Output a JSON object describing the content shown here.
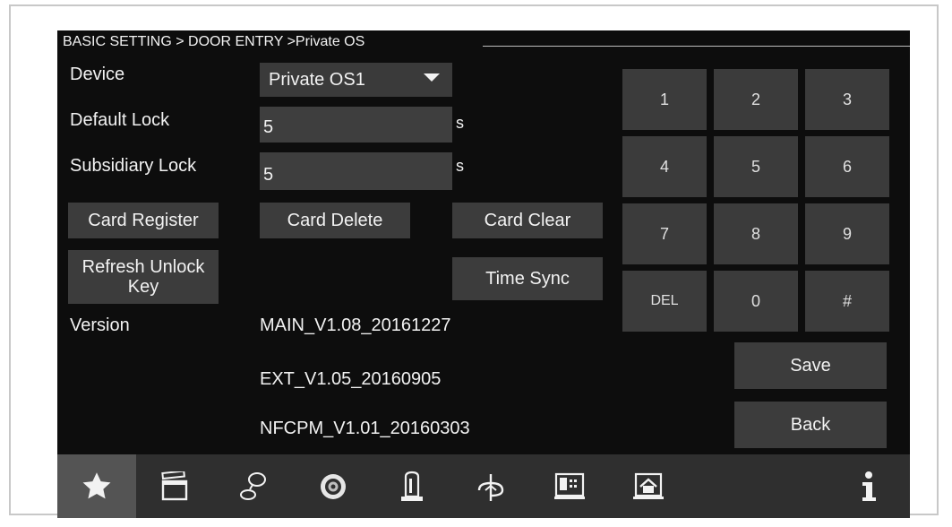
{
  "breadcrumb": "BASIC SETTING > DOOR ENTRY >Private OS",
  "form": {
    "device_label": "Device",
    "device_value": "Private OS1",
    "default_lock_label": "Default Lock",
    "default_lock_value": "5",
    "default_lock_unit": "s",
    "subsidiary_lock_label": "Subsidiary Lock",
    "subsidiary_lock_value": "5",
    "subsidiary_lock_unit": "s"
  },
  "buttons": {
    "card_register": "Card Register",
    "card_delete": "Card Delete",
    "card_clear": "Card Clear",
    "refresh_unlock_key_line1": "Refresh Unlock",
    "refresh_unlock_key_line2": "Key",
    "time_sync": "Time Sync",
    "save": "Save",
    "back": "Back"
  },
  "version": {
    "label": "Version",
    "main": "MAIN_V1.08_20161227",
    "ext": "EXT_V1.05_20160905",
    "nfcpm": "NFCPM_V1.01_20160303"
  },
  "keypad": [
    "1",
    "2",
    "3",
    "4",
    "5",
    "6",
    "7",
    "8",
    "9",
    "DEL",
    "0",
    "#"
  ],
  "navbar": {
    "active": "favorites-icon",
    "icons": [
      "star-icon",
      "clapperboard-icon",
      "intercom-icon",
      "camera-icon",
      "alarm-light-icon",
      "settings-dial-icon",
      "building-panel-icon",
      "home-icon",
      "info-icon"
    ]
  },
  "colors": {
    "screen_bg": "#0d0d0d",
    "button_bg": "#3c3c3c",
    "navbar_bg": "#2f2f2f",
    "text": "#f2f2f2"
  }
}
